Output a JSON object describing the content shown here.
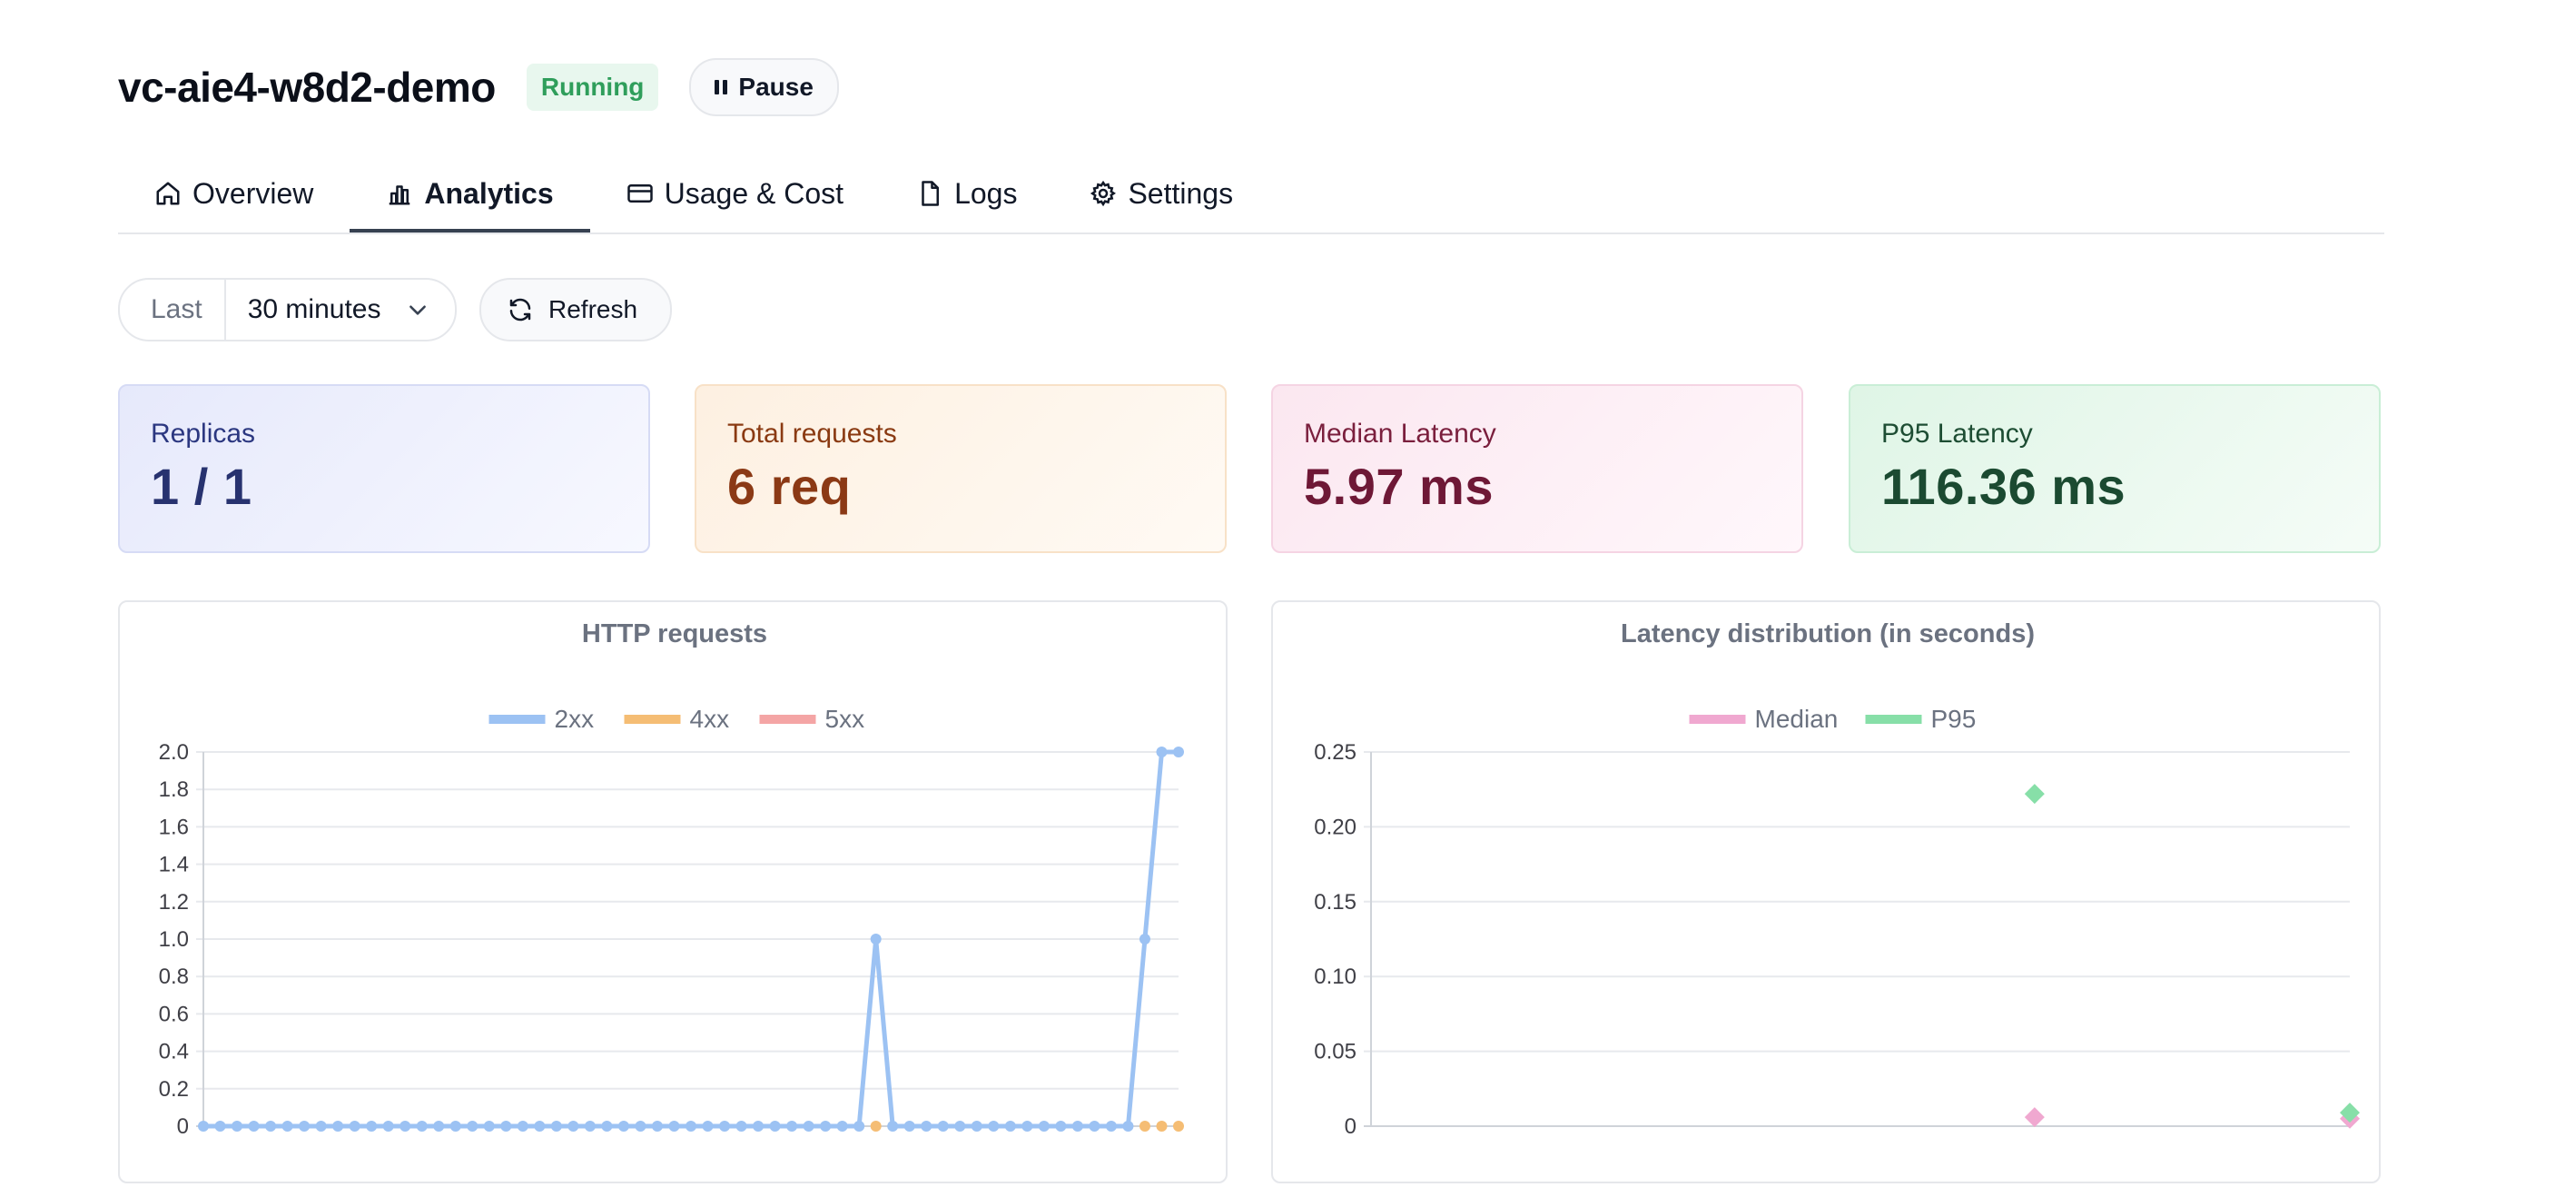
{
  "header": {
    "title": "vc-aie4-w8d2-demo",
    "status": "Running",
    "pause_label": "Pause"
  },
  "tabs": [
    {
      "label": "Overview",
      "icon": "home-icon",
      "active": false
    },
    {
      "label": "Analytics",
      "icon": "bar-chart-icon",
      "active": true
    },
    {
      "label": "Usage & Cost",
      "icon": "credit-card-icon",
      "active": false
    },
    {
      "label": "Logs",
      "icon": "file-icon",
      "active": false
    },
    {
      "label": "Settings",
      "icon": "gear-icon",
      "active": false
    }
  ],
  "controls": {
    "range_label": "Last",
    "range_value": "30 minutes",
    "refresh_label": "Refresh"
  },
  "metrics": [
    {
      "label": "Replicas",
      "value": "1 / 1"
    },
    {
      "label": "Total requests",
      "value": "6 req"
    },
    {
      "label": "Median Latency",
      "value": "5.97 ms"
    },
    {
      "label": "P95 Latency",
      "value": "116.36 ms"
    }
  ],
  "colors": {
    "accent_running": "#2f9e5b",
    "series_2xx": "#9cc2f3",
    "series_4xx": "#f5bd74",
    "series_5xx": "#f4a5a5",
    "series_median": "#f0a8d0",
    "series_p95": "#87dfa8"
  },
  "chart_data": [
    {
      "type": "line",
      "title": "HTTP requests",
      "ylim": [
        0,
        2.0
      ],
      "yticks": [
        "2.0",
        "1.8",
        "1.6",
        "1.4",
        "1.2",
        "1.0",
        "0.8",
        "0.6",
        "0.4",
        "0.2",
        "0"
      ],
      "grid": true,
      "legend": "top-center",
      "x_count": 60,
      "series": [
        {
          "name": "2xx",
          "color": "#9cc2f3",
          "values": [
            0,
            0,
            0,
            0,
            0,
            0,
            0,
            0,
            0,
            0,
            0,
            0,
            0,
            0,
            0,
            0,
            0,
            0,
            0,
            0,
            0,
            0,
            0,
            0,
            0,
            0,
            0,
            0,
            0,
            0,
            0,
            0,
            0,
            0,
            0,
            0,
            0,
            0,
            0,
            0,
            1,
            0,
            0,
            0,
            0,
            0,
            0,
            0,
            0,
            0,
            0,
            0,
            0,
            0,
            0,
            0,
            1,
            2,
            2
          ]
        },
        {
          "name": "4xx",
          "color": "#f5bd74",
          "values": [
            null,
            null,
            null,
            null,
            null,
            null,
            null,
            null,
            null,
            null,
            null,
            null,
            null,
            null,
            null,
            null,
            null,
            null,
            null,
            null,
            null,
            null,
            null,
            null,
            null,
            null,
            null,
            null,
            null,
            null,
            null,
            null,
            null,
            null,
            null,
            null,
            null,
            null,
            null,
            null,
            0,
            null,
            null,
            null,
            null,
            null,
            null,
            null,
            null,
            null,
            null,
            null,
            null,
            null,
            null,
            null,
            0,
            0,
            0
          ]
        },
        {
          "name": "5xx",
          "color": "#f4a5a5",
          "values": []
        }
      ]
    },
    {
      "type": "scatter",
      "title": "Latency distribution (in seconds)",
      "ylim": [
        0,
        0.25
      ],
      "yticks": [
        "0.25",
        "0.20",
        "0.15",
        "0.10",
        "0.05",
        "0"
      ],
      "grid": true,
      "legend": "top-center",
      "x_count": 60,
      "series": [
        {
          "name": "Median",
          "color": "#f0a8d0",
          "points": [
            {
              "x": 40,
              "y": 0.006
            },
            {
              "x": 59,
              "y": 0.005
            }
          ]
        },
        {
          "name": "P95",
          "color": "#87dfa8",
          "points": [
            {
              "x": 40,
              "y": 0.222
            },
            {
              "x": 59,
              "y": 0.009
            }
          ]
        }
      ]
    }
  ]
}
